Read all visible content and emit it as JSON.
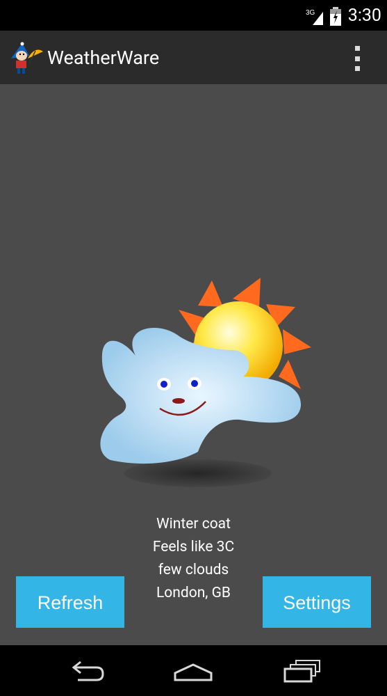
{
  "status_bar": {
    "network": "3G",
    "time": "3:30"
  },
  "app": {
    "title": "WeatherWare",
    "icon": "weather-person-umbrella-icon"
  },
  "menu": {
    "icon": "overflow-menu-icon"
  },
  "weather": {
    "icon": "partly-cloudy-sun-icon",
    "clothing": "Winter coat",
    "feels_like": "Feels like 3C",
    "description": "few clouds",
    "location": "London, GB"
  },
  "buttons": {
    "refresh": "Refresh",
    "settings": "Settings"
  },
  "nav": {
    "back": "back-icon",
    "home": "home-icon",
    "recent": "recent-apps-icon"
  },
  "colors": {
    "accent": "#33b5e5",
    "background": "#4b4b4b",
    "action_bar": "#2b2b2b"
  }
}
